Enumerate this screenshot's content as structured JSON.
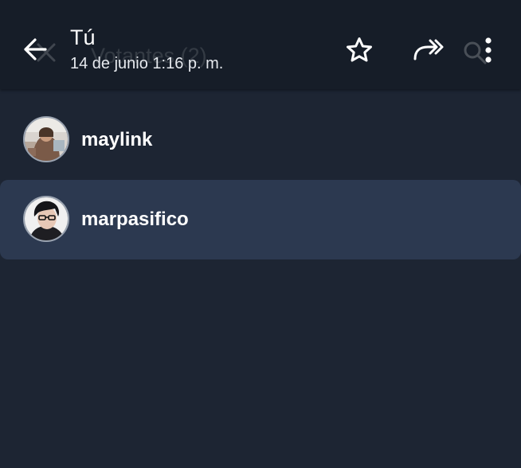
{
  "header": {
    "title": "Tú",
    "subtitle": "14 de junio 1:16 p. m.",
    "background_title": "Votantes (2)",
    "icons": {
      "back": "arrow-left-icon",
      "star": "star-outline-icon",
      "forward": "forward-double-arrow-icon",
      "more": "more-vertical-icon",
      "background_close": "close-icon",
      "background_search": "search-icon"
    }
  },
  "voters": [
    {
      "name": "maylink",
      "avatar": "avatar-photo",
      "selected": false
    },
    {
      "name": "marpasifico",
      "avatar": "avatar-photo",
      "selected": true
    }
  ],
  "colors": {
    "background": "#1d2533",
    "app_bar": "#161d28",
    "selected_row": "#2c3950",
    "text_primary": "#ffffff"
  }
}
